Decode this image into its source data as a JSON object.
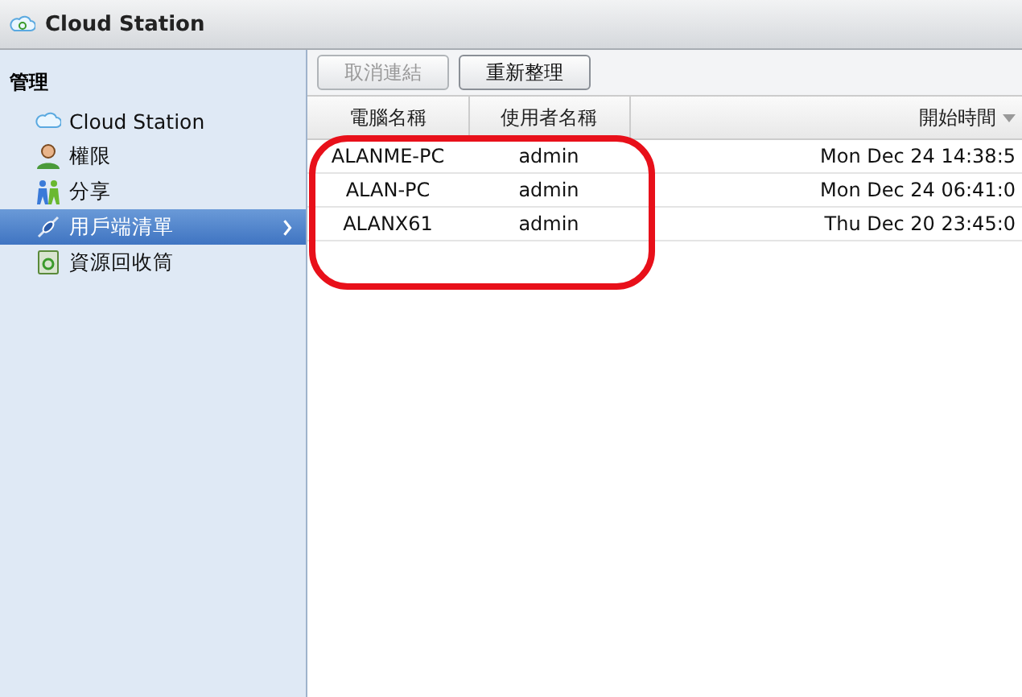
{
  "window": {
    "title": "Cloud Station"
  },
  "sidebar": {
    "heading": "管理",
    "items": [
      {
        "label": "Cloud Station",
        "kind": "cloud",
        "selected": false
      },
      {
        "label": "權限",
        "kind": "user",
        "selected": false
      },
      {
        "label": "分享",
        "kind": "share",
        "selected": false
      },
      {
        "label": "用戶端清單",
        "kind": "plug",
        "selected": true
      },
      {
        "label": "資源回收筒",
        "kind": "recycle",
        "selected": false
      }
    ]
  },
  "toolbar": {
    "buttons": [
      {
        "label": "取消連結",
        "disabled": true
      },
      {
        "label": "重新整理",
        "disabled": false
      }
    ]
  },
  "table": {
    "columns": [
      {
        "label": "電腦名稱",
        "sorted": false
      },
      {
        "label": "使用者名稱",
        "sorted": false
      },
      {
        "label": "開始時間",
        "sorted": true
      }
    ],
    "rows": [
      [
        "ALANME-PC",
        "admin",
        "Mon Dec 24 14:38:5"
      ],
      [
        "ALAN-PC",
        "admin",
        "Mon Dec 24 06:41:0"
      ],
      [
        "ALANX61",
        "admin",
        "Thu Dec 20 23:45:0"
      ]
    ]
  }
}
